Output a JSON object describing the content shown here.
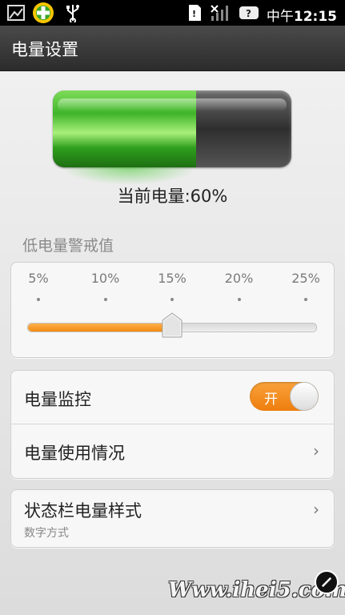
{
  "status_bar": {
    "time_prefix": "中午",
    "time": "12:15",
    "icons": [
      "notification-image-icon",
      "360-security-icon",
      "usb-icon",
      "sd-card-icon",
      "no-signal-icon",
      "help-icon"
    ]
  },
  "header": {
    "title": "电量设置"
  },
  "battery": {
    "level": 0.6,
    "label": "当前电量:60%",
    "fill_color": "#3fb52a"
  },
  "low_battery": {
    "section_label": "低电量警戒值",
    "ticks": [
      "5%",
      "10%",
      "15%",
      "20%",
      "25%"
    ],
    "selected": "15%",
    "accent": "#f28a10"
  },
  "monitor": {
    "label": "电量监控",
    "toggle_label": "开",
    "toggle_on": true
  },
  "usage": {
    "label": "电量使用情况"
  },
  "statusbar_style": {
    "label": "状态栏电量样式",
    "value": "数字方式"
  },
  "watermark": {
    "text": "Www.ihei5.com"
  }
}
